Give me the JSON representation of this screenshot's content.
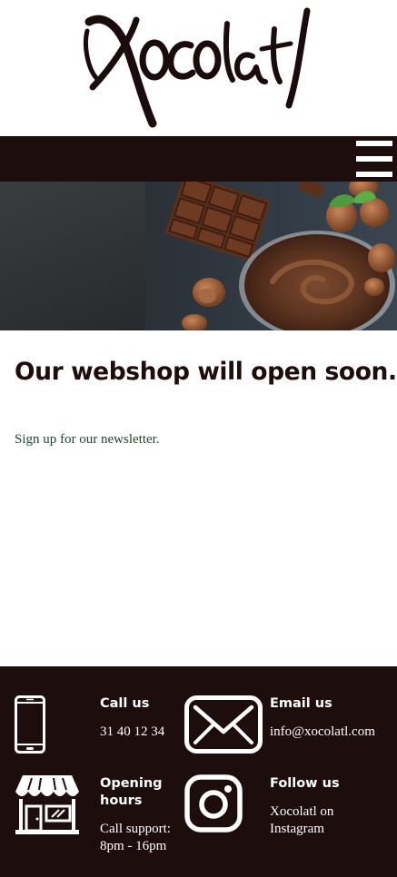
{
  "logo": {
    "text": "Xocolatl",
    "icon": "xocolatl-wordmark"
  },
  "nav": {
    "menu_icon": "hamburger-icon"
  },
  "hero": {
    "image": "chocolate-hazelnut-spread-photo"
  },
  "main": {
    "title": "Our webshop will open soon...",
    "newsletter_link": "Sign up for our newsletter."
  },
  "footer": {
    "call": {
      "icon": "phone-icon",
      "title": "Call us",
      "value": "31 40 12 34"
    },
    "email": {
      "icon": "envelope-icon",
      "title": "Email us",
      "value": "info@xocolatl.com"
    },
    "hours": {
      "icon": "storefront-icon",
      "title": "Opening hours",
      "value": "Call support: 8pm - 16pm"
    },
    "follow": {
      "icon": "instagram-icon",
      "title": "Follow us",
      "value": "Xocolatl on Instagram"
    }
  },
  "colors": {
    "brand_dark": "#1e0d0d",
    "link_green": "#1d4a28",
    "white": "#ffffff"
  }
}
